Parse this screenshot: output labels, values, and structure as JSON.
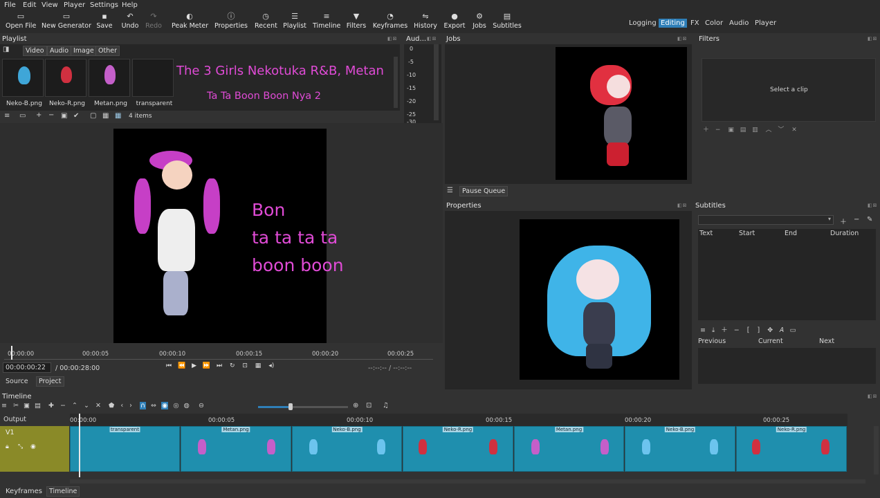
{
  "menu": [
    "File",
    "Edit",
    "View",
    "Player",
    "Settings",
    "Help"
  ],
  "toolbar": {
    "open": "Open File",
    "newgen": "New Generator",
    "save": "Save",
    "undo": "Undo",
    "redo": "Redo",
    "peak": "Peak Meter",
    "properties": "Properties",
    "recent": "Recent",
    "playlist": "Playlist",
    "timeline": "Timeline",
    "filters": "Filters",
    "keyframes": "Keyframes",
    "history": "History",
    "export": "Export",
    "jobs": "Jobs",
    "subtitles": "Subtitles"
  },
  "workspaces": [
    "Logging",
    "Editing",
    "FX",
    "Color",
    "Audio",
    "Player"
  ],
  "playlist": {
    "title": "Playlist",
    "tabs": [
      "Video",
      "Audio",
      "Image",
      "Other"
    ],
    "items": [
      "Neko-B.png",
      "Neko-R.png",
      "Metan.png",
      "transparent"
    ],
    "count": "4 items"
  },
  "overlay": {
    "line1": "The 3 Girls Nekotuka R&B, Metan",
    "line2": "Ta Ta Boon Boon Nya 2"
  },
  "audio": {
    "title": "Aud...",
    "ticks": [
      "0",
      "-5",
      "-10",
      "-15",
      "-20",
      "-25",
      "-30"
    ]
  },
  "jobs": {
    "title": "Jobs",
    "pause": "Pause Queue"
  },
  "filters": {
    "title": "Filters",
    "hint": "Select a clip"
  },
  "properties": {
    "title": "Properties"
  },
  "subtitles": {
    "title": "Subtitles",
    "cols": [
      "Text",
      "Start",
      "End",
      "Duration"
    ],
    "nav": [
      "Previous",
      "Current",
      "Next"
    ]
  },
  "player": {
    "lyric1": "Bon",
    "lyric2": "ta ta ta ta",
    "lyric3": "boon boon",
    "ruler": [
      "00:00:00",
      "00:00:05",
      "00:00:10",
      "00:00:15",
      "00:00:20",
      "00:00:25"
    ],
    "current": "00:00:00:22",
    "total": "/ 00:00:28:00",
    "inout": "--:--:-- / --:--:--",
    "source": "Source",
    "project": "Project"
  },
  "timeline": {
    "title": "Timeline",
    "output": "Output",
    "track": "V1",
    "ruler": [
      "00:00:00",
      "00:00:05",
      "00:00:10",
      "00:00:15",
      "00:00:20",
      "00:00:25"
    ],
    "clips": [
      "transparent",
      "Metan.png",
      "Neko-B.png",
      "Neko-R.png",
      "Metan.png",
      "Neko-B.png",
      "Neko-R.png"
    ]
  },
  "bottom_tabs": [
    "Keyframes",
    "Timeline"
  ],
  "colors": {
    "accent": "#2f7fb8",
    "magenta": "#e04bd6",
    "clip": "#1f8fae",
    "track": "#8a8a28"
  }
}
